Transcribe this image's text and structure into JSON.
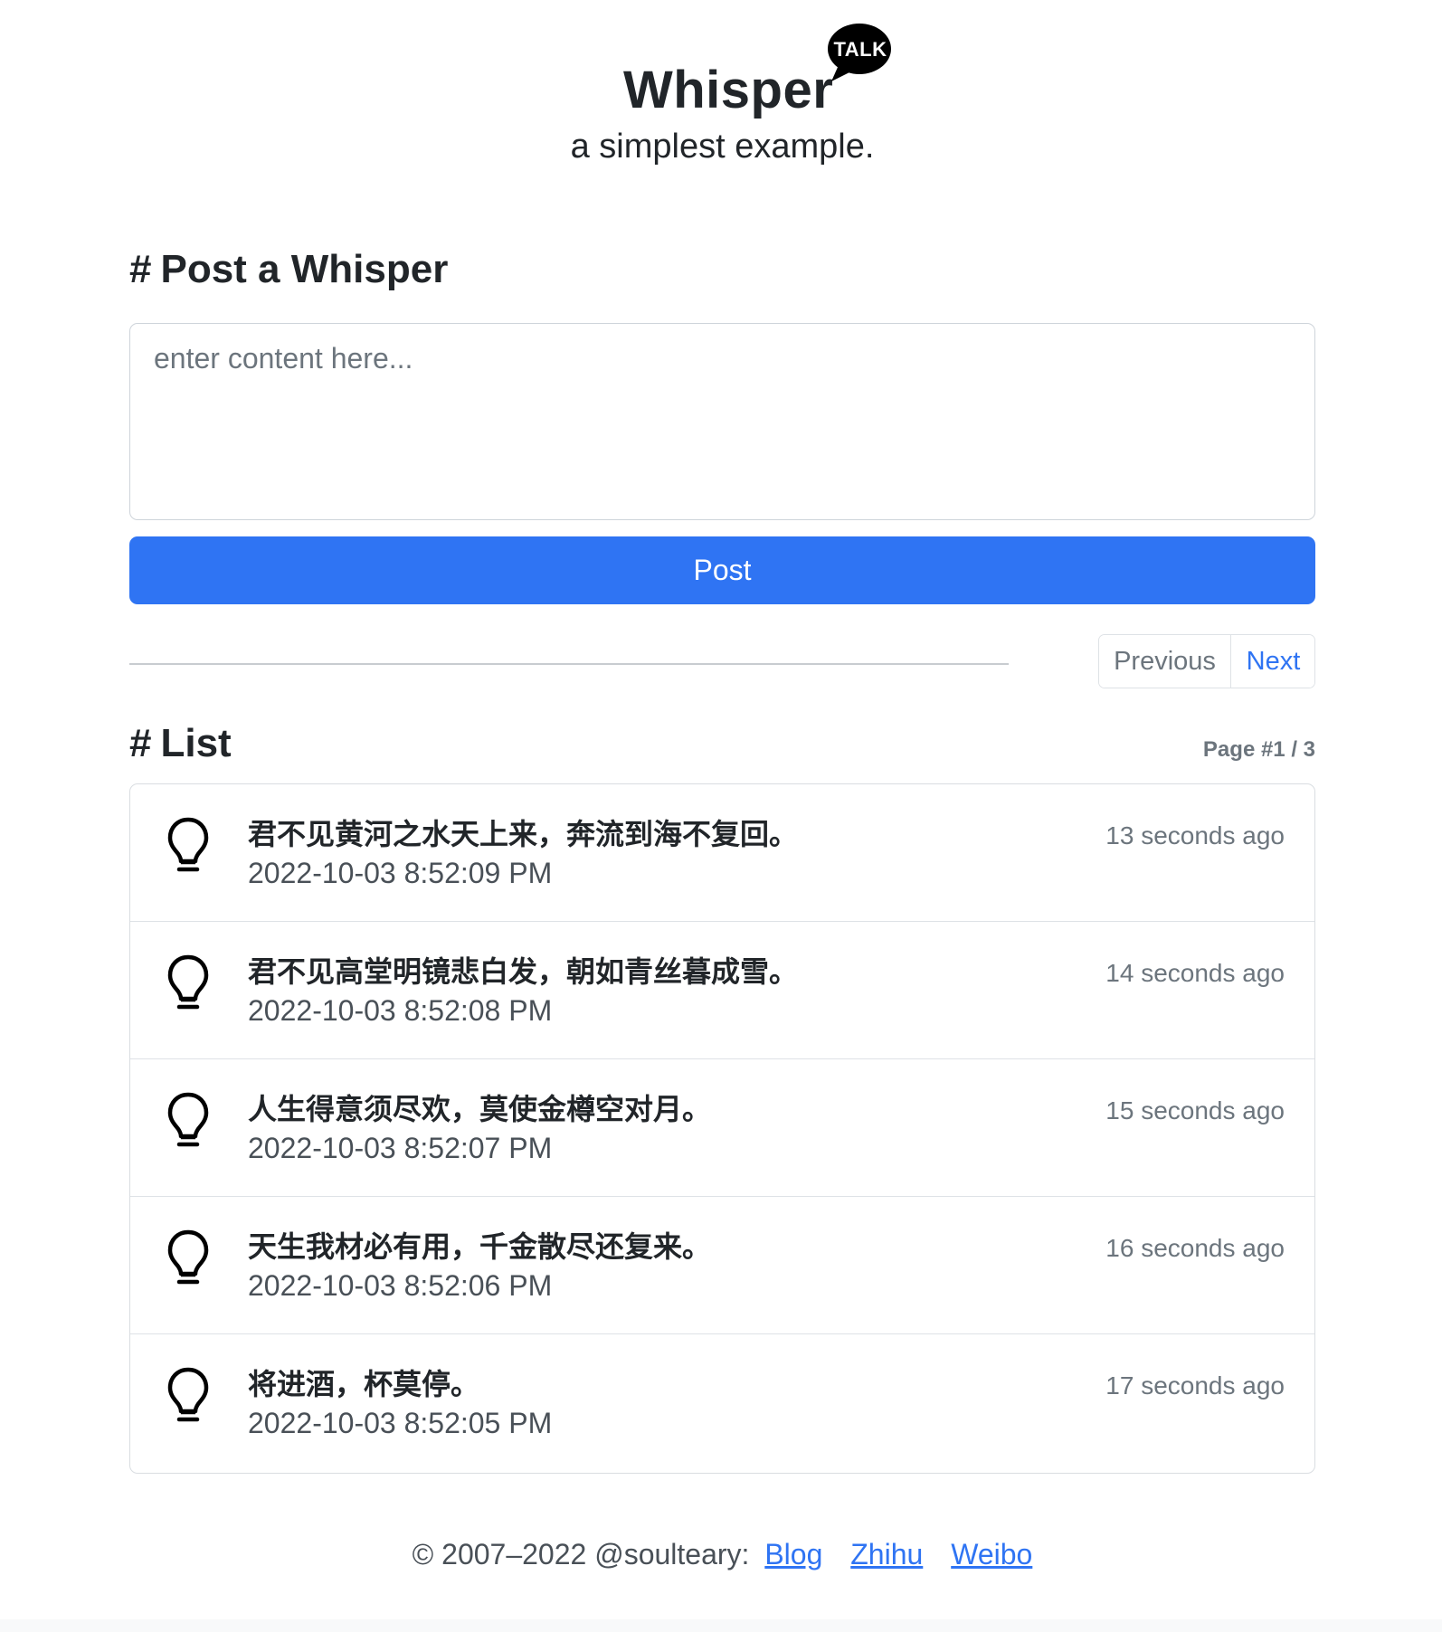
{
  "header": {
    "title": "Whisper",
    "badge": "TALK",
    "subtitle": "a simplest example."
  },
  "post_section": {
    "heading_hash": "#",
    "heading": "Post a Whisper",
    "placeholder": "enter content here...",
    "value": "",
    "post_label": "Post"
  },
  "pagination": {
    "previous_label": "Previous",
    "next_label": "Next"
  },
  "list_section": {
    "heading_hash": "#",
    "heading": "List",
    "page_indicator": "Page #1 / 3",
    "items": [
      {
        "text": "君不见黄河之水天上来，奔流到海不复回。",
        "date": "2022-10-03 8:52:09 PM",
        "ago": "13 seconds ago",
        "icon": "lightbulb-icon"
      },
      {
        "text": "君不见高堂明镜悲白发，朝如青丝暮成雪。",
        "date": "2022-10-03 8:52:08 PM",
        "ago": "14 seconds ago",
        "icon": "lightbulb-icon"
      },
      {
        "text": "人生得意须尽欢，莫使金樽空对月。",
        "date": "2022-10-03 8:52:07 PM",
        "ago": "15 seconds ago",
        "icon": "lightbulb-icon"
      },
      {
        "text": "天生我材必有用，千金散尽还复来。",
        "date": "2022-10-03 8:52:06 PM",
        "ago": "16 seconds ago",
        "icon": "lightbulb-icon"
      },
      {
        "text": "将进酒，杯莫停。",
        "date": "2022-10-03 8:52:05 PM",
        "ago": "17 seconds ago",
        "icon": "lightbulb-icon"
      }
    ]
  },
  "footer": {
    "copyright": "© 2007–2022 @soulteary:",
    "links": [
      "Blog",
      "Zhihu",
      "Weibo"
    ]
  },
  "colors": {
    "primary": "#2f74f3",
    "text": "#212529",
    "muted": "#6c757d",
    "border": "#dee2e6"
  }
}
